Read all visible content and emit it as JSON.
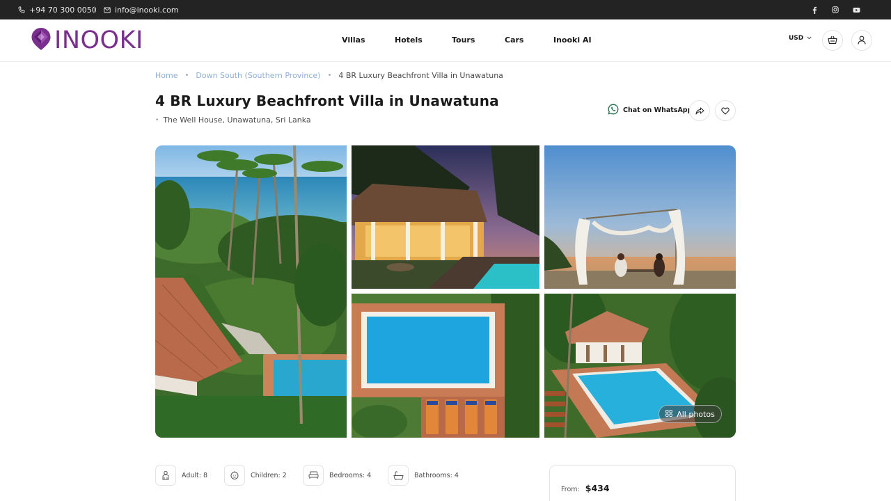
{
  "topbar": {
    "phone": "+94 70 300 0050",
    "email": "info@inooki.com",
    "socials": [
      "facebook-icon",
      "instagram-icon",
      "youtube-icon"
    ]
  },
  "header": {
    "logo_text": "INOOKI",
    "nav": [
      "Villas",
      "Hotels",
      "Tours",
      "Cars",
      "Inooki AI"
    ],
    "currency": "USD"
  },
  "breadcrumb": {
    "items": [
      "Home",
      "Down South (Southern Province)",
      "4 BR Luxury Beachfront Villa in Unawatuna"
    ]
  },
  "listing": {
    "title": "4 BR Luxury Beachfront Villa in Unawatuna",
    "location": "The Well House, Unawatuna, Sri Lanka",
    "whatsapp_label": "Chat on WhatsApp"
  },
  "gallery": {
    "all_photos_label": "All photos",
    "photos": [
      "aerial-villa-photo",
      "veranda-night-photo",
      "beach-dinner-photo",
      "pool-aerial-photo",
      "villa-pool-photo"
    ]
  },
  "features": {
    "adult": "Adult: 8",
    "children": "Children: 2",
    "bedrooms": "Bedrooms: 4",
    "bathrooms": "Bathrooms: 4"
  },
  "price": {
    "from_label": "From:",
    "amount": "$434"
  },
  "colors": {
    "brand": "#7a2f8f",
    "topbar_bg": "#232323",
    "link": "#8fb0d2",
    "whatsapp": "#1a1a1a"
  }
}
